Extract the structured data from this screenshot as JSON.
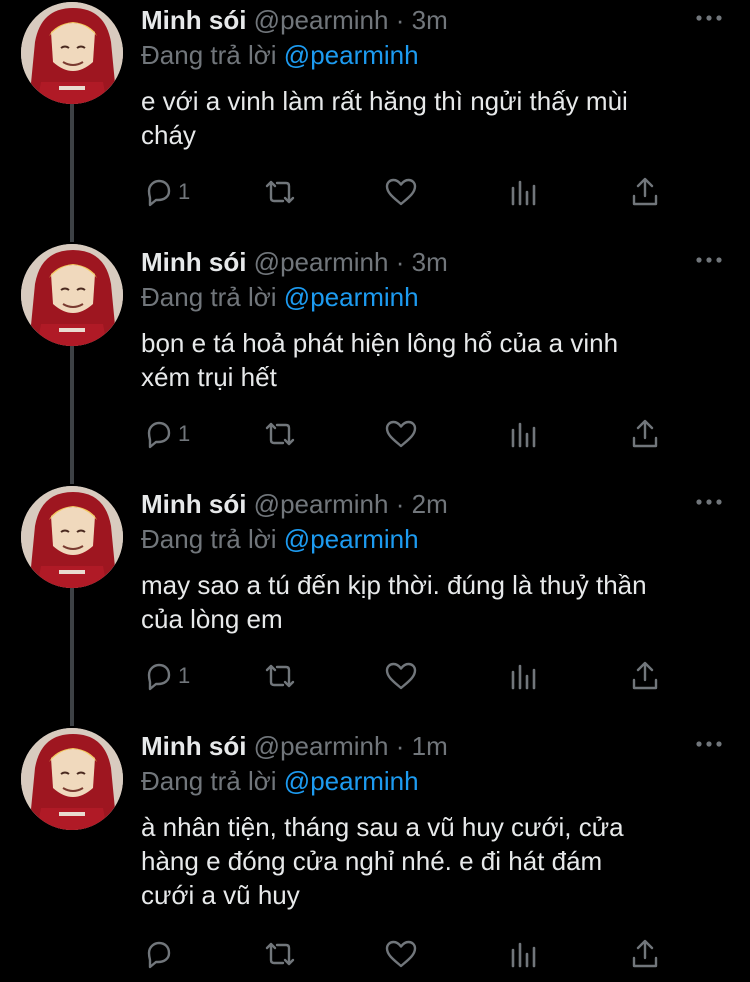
{
  "tweets": [
    {
      "name": "Minh sói",
      "handle": "@pearminh",
      "separator": "·",
      "time": "3m",
      "reply_prefix": "Đang trả lời",
      "reply_to": "@pearminh",
      "lines": [
        "e với a vinh làm rất hăng thì ngửi thấy mùi",
        "cháy"
      ],
      "reply_count": "1"
    },
    {
      "name": "Minh sói",
      "handle": "@pearminh",
      "separator": "·",
      "time": "3m",
      "reply_prefix": "Đang trả lời",
      "reply_to": "@pearminh",
      "lines": [
        "bọn e tá hoả phát hiện lông hổ của a vinh",
        "xém trụi hết"
      ],
      "reply_count": "1"
    },
    {
      "name": "Minh sói",
      "handle": "@pearminh",
      "separator": "·",
      "time": "2m",
      "reply_prefix": "Đang trả lời",
      "reply_to": "@pearminh",
      "lines": [
        "may sao a tú đến kịp thời. đúng là thuỷ thần",
        "của lòng em"
      ],
      "reply_count": "1"
    },
    {
      "name": "Minh sói",
      "handle": "@pearminh",
      "separator": "·",
      "time": "1m",
      "reply_prefix": "Đang trả lời",
      "reply_to": "@pearminh",
      "lines": [
        "à nhân tiện, tháng sau a vũ huy cưới, cửa",
        "hàng e đóng cửa nghỉ nhé. e đi hát đám",
        "cưới a vũ huy"
      ],
      "reply_count": ""
    }
  ],
  "icons": [
    "reply-icon",
    "retweet-icon",
    "like-icon",
    "views-icon",
    "share-icon",
    "more-icon"
  ],
  "colors": {
    "background": "#000000",
    "text": "#e7e9ea",
    "muted": "#71767b",
    "mention": "#1d9bf0",
    "thread_line": "#3d4145"
  }
}
